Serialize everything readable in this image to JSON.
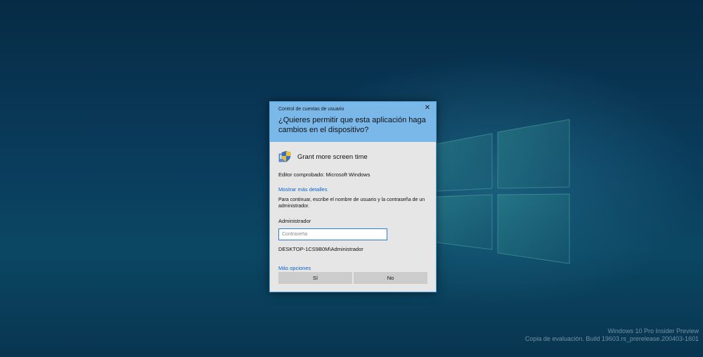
{
  "dialog": {
    "caption": "Control de cuentas de usuario",
    "close_glyph": "✕",
    "question": "¿Quieres permitir que esta aplicación haga cambios en el dispositivo?",
    "app_name": "Grant more screen time",
    "app_icon": "uac-shield-icon",
    "publisher": "Editor comprobado: Microsoft Windows",
    "details_link": "Mostrar más detalles",
    "instructions": "Para continuar, escribe el nombre de usuario y la contraseña de un administrador.",
    "user_label": "Administrador",
    "password_placeholder": "Contraseña",
    "password_value": "",
    "domain_user": "DESKTOP-1CS9B0M\\Administrador",
    "more_options_link": "Más opciones",
    "yes_label": "Sí",
    "no_label": "No"
  },
  "watermark": {
    "line1": "Windows 10 Pro Insider Preview",
    "line2": "Copia de evaluación. Build 19603.rs_prerelease.200403-1601"
  },
  "colors": {
    "header": "#7ab8ea",
    "body": "#e6e6e6",
    "link": "#0a64c8",
    "button": "#cccccc",
    "desktop": "#0a3c5c"
  }
}
